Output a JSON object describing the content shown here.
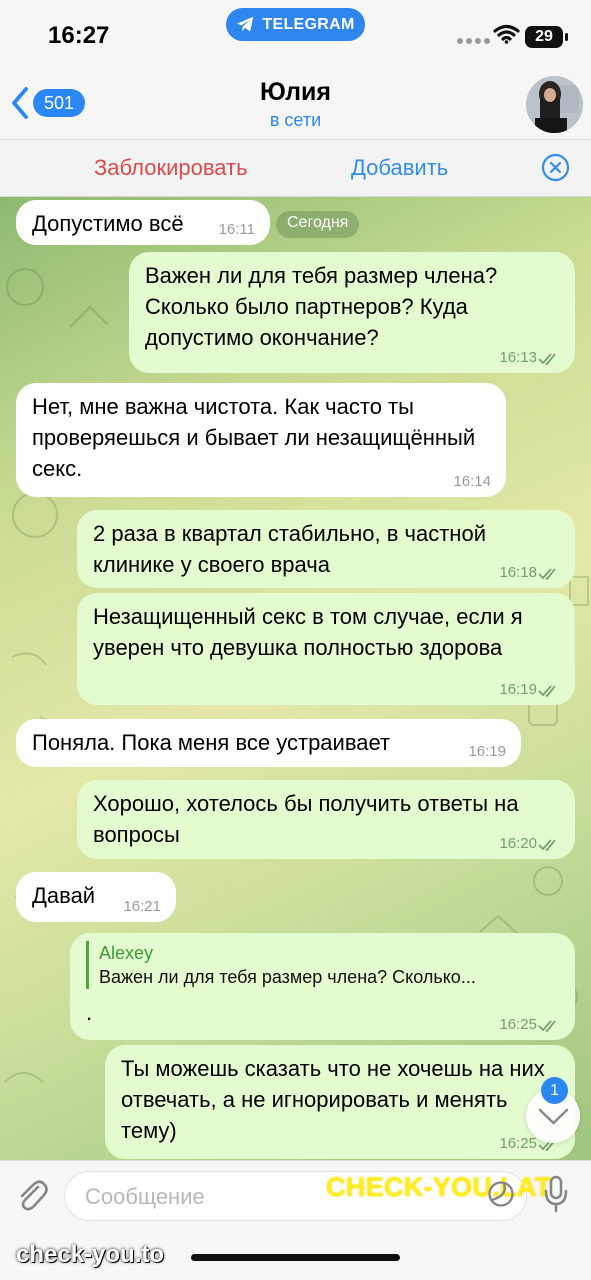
{
  "status_bar": {
    "time": "16:27",
    "source_app": "TELEGRAM",
    "battery": "29"
  },
  "header": {
    "back_unread_count": "501",
    "title": "Юлия",
    "status": "в сети"
  },
  "actions": {
    "block_label": "Заблокировать",
    "add_label": "Добавить"
  },
  "chat": {
    "day_label": "Сегодня",
    "messages": [
      {
        "direction": "in",
        "text": "Допустимо всё",
        "time": "16:11"
      },
      {
        "direction": "out",
        "text": "Важен ли для тебя размер члена? Сколько было партнеров? Куда допустимо окончание?",
        "time": "16:13",
        "status": "read"
      },
      {
        "direction": "in",
        "text": "Нет, мне важна чистота. Как часто ты проверяешься и бывает ли незащищённый секс.",
        "time": "16:14"
      },
      {
        "direction": "out",
        "text": "2 раза в квартал стабильно, в частной клинике у своего врача",
        "time": "16:18",
        "status": "read"
      },
      {
        "direction": "out",
        "text": "Незащищенный секс в том случае, если я уверен что девушка полностью здорова",
        "time": "16:19",
        "status": "read"
      },
      {
        "direction": "in",
        "text": "Поняла. Пока меня все устраивает",
        "time": "16:19"
      },
      {
        "direction": "out",
        "text": "Хорошо, хотелось бы получить ответы на вопросы",
        "time": "16:20",
        "status": "read"
      },
      {
        "direction": "in",
        "text": "Давай",
        "time": "16:21"
      },
      {
        "direction": "out",
        "reply_to": {
          "author": "Alexey",
          "preview": "Важен ли для тебя размер члена? Сколько..."
        },
        "text": ".",
        "time": "16:25",
        "status": "read"
      },
      {
        "direction": "out",
        "text": "Ты можешь сказать что не хочешь на них отвечать, а не игнорировать и менять тему)",
        "time": "16:25",
        "status": "read"
      }
    ],
    "unread_scroll_count": "1"
  },
  "composer": {
    "placeholder": "Сообщение"
  },
  "watermarks": {
    "left": "check-you.to",
    "right": "CHECK-YOU.LAT"
  },
  "icons": {
    "back": "chevron-left-icon",
    "close": "close-circle-icon",
    "attach": "paperclip-icon",
    "sticker": "sticker-icon",
    "mic": "microphone-icon",
    "scroll": "chevron-down-icon"
  },
  "colors": {
    "accent_blue": "#2a87f5",
    "block_red": "#de4a4a",
    "outgoing_bubble": "#e4fbcf",
    "incoming_bubble": "#ffffff",
    "read_check": "#70a166"
  }
}
